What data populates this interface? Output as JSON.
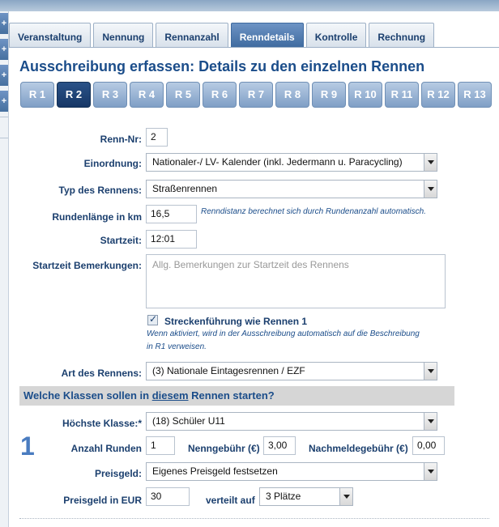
{
  "rail": [
    "+",
    "+",
    "+",
    "+"
  ],
  "tabs": [
    {
      "label": "Veranstaltung"
    },
    {
      "label": "Nennung"
    },
    {
      "label": "Rennanzahl"
    },
    {
      "label": "Renndetails"
    },
    {
      "label": "Kontrolle"
    },
    {
      "label": "Rechnung"
    }
  ],
  "active_tab": "Renndetails",
  "title": "Ausschreibung erfassen: Details zu den einzelnen Rennen",
  "race_tabs": [
    "R 1",
    "R 2",
    "R 3",
    "R 4",
    "R 5",
    "R 6",
    "R 7",
    "R 8",
    "R 9",
    "R 10",
    "R 11",
    "R 12",
    "R 13"
  ],
  "active_race": "R 2",
  "form": {
    "renn_nr_label": "Renn-Nr:",
    "renn_nr_value": "2",
    "einordnung_label": "Einordnung:",
    "einordnung_value": "Nationaler-/ LV- Kalender (inkl. Jedermann u. Paracycling)",
    "typ_label": "Typ des Rennens:",
    "typ_value": "Straßenrennen",
    "rundenlaenge_label": "Rundenlänge in km",
    "rundenlaenge_value": "16,5",
    "rundenlaenge_hint": "Renndistanz berechnet sich durch Rundenanzahl automatisch.",
    "startzeit_label": "Startzeit:",
    "startzeit_value": "12:01",
    "bemerkung_label": "Startzeit Bemerkungen:",
    "bemerkung_placeholder": "Allg. Bemerkungen zur Startzeit des Rennens",
    "strecke_label": "Streckenführung wie Rennen 1",
    "strecke_hint_1": "Wenn aktiviert, wird in der Ausschreibung automatisch auf die Beschreibung",
    "strecke_hint_2": "in R1 verweisen.",
    "art_label": "Art des Rennens:",
    "art_value": "(3) Nationale Eintagesrennen / EZF"
  },
  "section": {
    "prefix": "Welche Klassen sollen in ",
    "emph": "diesem",
    "suffix": " Rennen starten?"
  },
  "klasse": {
    "number": "1",
    "hoechste_label": "Höchste Klasse:*",
    "hoechste_value": "(18) Schüler U11",
    "runden_label": "Anzahl Runden",
    "runden_value": "1",
    "nenngebuehr_label": "Nenngebühr (€)",
    "nenngebuehr_value": "3,00",
    "nachmelde_label": "Nachmeldegebühr (€)",
    "nachmelde_value": "0,00",
    "preisgeld_label": "Preisgeld:",
    "preisgeld_value": "Eigenes Preisgeld festsetzen",
    "preisgeld_eur_label": "Preisgeld in EUR",
    "preisgeld_eur_value": "30",
    "verteilt_label": "verteilt auf",
    "verteilt_value": "3 Plätze"
  }
}
